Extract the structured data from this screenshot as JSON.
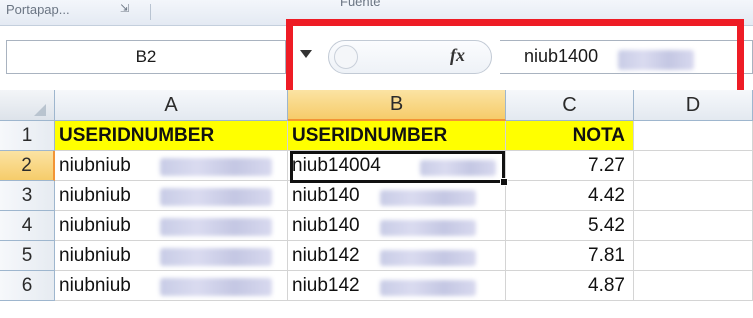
{
  "ribbon": {
    "groups": [
      "Portapap...",
      "Fuente"
    ],
    "launcher_glyph": "⇲"
  },
  "formula_bar": {
    "name_box": "B2",
    "fx_label": "fx",
    "formula_value": "niub1400"
  },
  "sheet": {
    "columns": [
      "A",
      "B",
      "C",
      "D"
    ],
    "selected_column": "B",
    "selected_row": "2",
    "rows": [
      {
        "num": "1",
        "a": "USERIDNUMBER",
        "b": "USERIDNUMBER",
        "c": "NOTA"
      },
      {
        "num": "2",
        "a": "niubniub",
        "b": "niub14004",
        "c": "7.27"
      },
      {
        "num": "3",
        "a": "niubniub",
        "b": "niub140",
        "c": "4.42"
      },
      {
        "num": "4",
        "a": "niubniub",
        "b": "niub140",
        "c": "5.42"
      },
      {
        "num": "5",
        "a": "niubniub",
        "b": "niub142",
        "c": "7.81"
      },
      {
        "num": "6",
        "a": "niubniub",
        "b": "niub142",
        "c": "4.87"
      }
    ]
  },
  "colors": {
    "highlight": "#ee1c25",
    "header_fill": "#ffff00",
    "selected_header": "#f6cc6a"
  }
}
